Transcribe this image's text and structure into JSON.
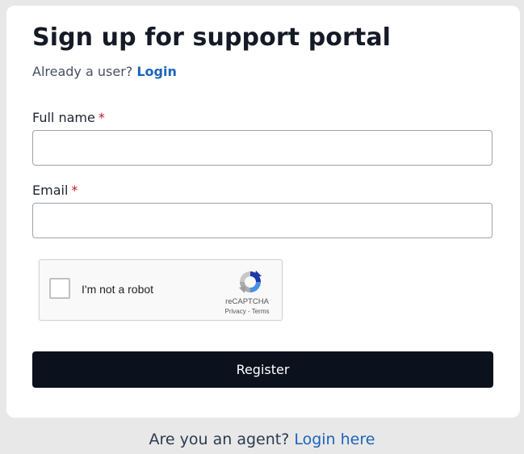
{
  "form": {
    "title": "Sign up for support portal",
    "already_user_text": "Already a user?",
    "login_link": "Login",
    "fields": [
      {
        "label": "Full name",
        "required_marker": "*",
        "value": ""
      },
      {
        "label": "Email",
        "required_marker": "*",
        "value": ""
      }
    ],
    "captcha": {
      "label": "I'm not a robot",
      "brand": "reCAPTCHA",
      "privacy": "Privacy",
      "separator": "-",
      "terms": "Terms",
      "checked": false
    },
    "register_label": "Register"
  },
  "footer": {
    "question": "Are you an agent?",
    "login_link": "Login here"
  },
  "colors": {
    "link": "#1b64b8",
    "required": "#c0182a",
    "button_bg": "#0c121d",
    "page_bg": "#e8e8e8"
  },
  "icons": [
    "recaptcha-logo-icon"
  ]
}
